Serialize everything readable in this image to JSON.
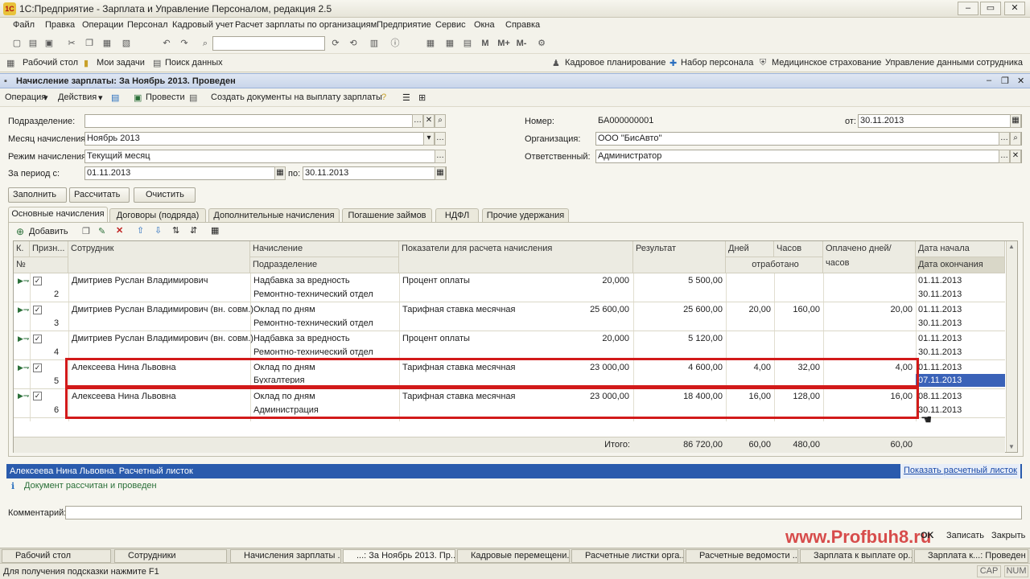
{
  "window": {
    "title": "1С:Предприятие - Зарплата и Управление Персоналом, редакция 2.5",
    "logo": "1С"
  },
  "menu": [
    "Файл",
    "Правка",
    "Операции",
    "Персонал",
    "Кадровый учет",
    "Расчет зарплаты по организациям",
    "Предприятие",
    "Сервис",
    "Окна",
    "Справка"
  ],
  "toolbar_extra": [
    "M",
    "M+",
    "M-"
  ],
  "quickbar": {
    "left": [
      "Рабочий стол",
      "Мои задачи",
      "Поиск данных"
    ],
    "right": [
      "Кадровое планирование",
      "Набор персонала",
      "Медицинское страхование",
      "Управление данными сотрудника"
    ]
  },
  "doc": {
    "title": "Начисление зарплаты: За Ноябрь 2013. Проведен",
    "commands": [
      "Операция",
      "Действия",
      "Провести",
      "Создать документы на выплату зарплаты"
    ]
  },
  "form": {
    "labels": {
      "podrazdelenie": "Подразделение:",
      "month": "Месяц начисления:",
      "mode": "Режим начисления:",
      "period_from": "За период с:",
      "period_to": "по:",
      "number": "Номер:",
      "date": "от:",
      "org": "Организация:",
      "resp": "Ответственный:",
      "comment": "Комментарий:"
    },
    "values": {
      "podrazdelenie": "",
      "month": "Ноябрь 2013",
      "mode": "Текущий месяц",
      "period_from": "01.11.2013",
      "period_to": "30.11.2013",
      "number": "БА000000001",
      "date": "30.11.2013",
      "org": "ООО \"БисАвто\"",
      "resp": "Администратор",
      "comment": ""
    },
    "buttons": [
      "Заполнить",
      "Рассчитать",
      "Очистить"
    ]
  },
  "tabs": [
    "Основные начисления",
    "Договоры (подряда)",
    "Дополнительные начисления",
    "Погашение займов",
    "НДФЛ",
    "Прочие удержания"
  ],
  "grid": {
    "add_button": "Добавить",
    "headers": {
      "k": "К.",
      "priz": "Призн...",
      "no": "№",
      "emp": "Сотрудник",
      "nach": "Начисление",
      "dept": "Подразделение",
      "pokaz": "Показатели для расчета начисления",
      "result": "Результат",
      "days": "Дней",
      "hours": "Часов",
      "otrab": "отработано",
      "oplach": "Оплачено дней/часов",
      "start": "Дата начала",
      "end": "Дата окончания"
    },
    "rows": [
      {
        "n": "2",
        "emp": "Дмитриев Руслан Владимирович",
        "nach": "Надбавка за вредность",
        "dept": "Ремонтно-технический отдел",
        "pok": "Процент оплаты",
        "pokval": "20,000",
        "res": "5 500,00",
        "days": "",
        "hours": "",
        "opl": "",
        "start": "01.11.2013",
        "end": "30.11.2013"
      },
      {
        "n": "3",
        "emp": "Дмитриев Руслан Владимирович (вн. совм.)",
        "nach": "Оклад по дням",
        "dept": "Ремонтно-технический отдел",
        "pok": "Тарифная ставка месячная",
        "pokval": "25 600,00",
        "res": "25 600,00",
        "days": "20,00",
        "hours": "160,00",
        "opl": "20,00",
        "start": "01.11.2013",
        "end": "30.11.2013"
      },
      {
        "n": "4",
        "emp": "Дмитриев Руслан Владимирович (вн. совм.)",
        "nach": "Надбавка за вредность",
        "dept": "Ремонтно-технический отдел",
        "pok": "Процент оплаты",
        "pokval": "20,000",
        "res": "5 120,00",
        "days": "",
        "hours": "",
        "opl": "",
        "start": "01.11.2013",
        "end": "30.11.2013"
      },
      {
        "n": "5",
        "emp": "Алексеева Нина Львовна",
        "nach": "Оклад по дням",
        "dept": "Бухгалтерия",
        "pok": "Тарифная ставка месячная",
        "pokval": "23 000,00",
        "res": "4 600,00",
        "days": "4,00",
        "hours": "32,00",
        "opl": "4,00",
        "start": "01.11.2013",
        "end": "07.11.2013"
      },
      {
        "n": "6",
        "emp": "Алексеева Нина Львовна",
        "nach": "Оклад по дням",
        "dept": "Администрация",
        "pok": "Тарифная ставка месячная",
        "pokval": "23 000,00",
        "res": "18 400,00",
        "days": "16,00",
        "hours": "128,00",
        "opl": "16,00",
        "start": "08.11.2013",
        "end": "30.11.2013"
      }
    ],
    "totals": {
      "label": "Итого:",
      "res": "86 720,00",
      "days": "60,00",
      "hours": "480,00",
      "opl": "60,00"
    }
  },
  "status": {
    "left": "Алексеева Нина Львовна. Расчетный листок",
    "right": "Показать расчетный листок",
    "info": "Документ рассчитан и проведен"
  },
  "footer_buttons": [
    "OK",
    "Записать",
    "Закрыть"
  ],
  "taskbar": [
    "Рабочий стол",
    "Сотрудники",
    "Начисления зарплаты ...",
    "...: За Ноябрь 2013. Пр...",
    "Кадровые перемещени...",
    "Расчетные листки орга...",
    "Расчетные ведомости ...",
    "Зарплата к выплате ор...",
    "Зарплата к...: Проведен"
  ],
  "bottom": {
    "hint": "Для получения подсказки нажмите F1",
    "cap": "CAP",
    "num": "NUM"
  },
  "watermark": "www.Profbuh8.ru",
  "colors": {
    "red": "#d21a1a",
    "selection": "#3a62b8",
    "status_blue": "#2a5bad"
  }
}
